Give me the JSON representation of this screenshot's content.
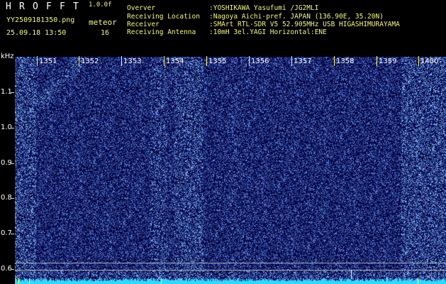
{
  "header": {
    "logo_letters": [
      "H",
      "R",
      "O",
      "F",
      "F",
      "T"
    ],
    "version": "1.0.0f",
    "filename": "YY2509181350.png",
    "datetime": "25.09.18 13:50",
    "meteor_label": "meteor",
    "meteor_count": "16",
    "info": [
      {
        "label": "Overver",
        "value": ":YOSHIKAWA Yasufumi /JG2MLI"
      },
      {
        "label": "Receiving Location",
        "value": ":Nagoya Aichi-pref. JAPAN (136.90E, 35.20N)"
      },
      {
        "label": "Receiver",
        "value": ":SMArt RTL-SDR V5 52.905MHz USB HIGASHIMURAYAMA"
      },
      {
        "label": "Receiving Antenna",
        "value": ":10mH 3el.YAGI Horizontal:ENE"
      }
    ]
  },
  "axis": {
    "y_unit": "kHz",
    "y_labels": [
      "1.1",
      "1.0",
      "0.9",
      "0.8",
      "0.7",
      "0.6"
    ],
    "x_labels": [
      "1351",
      "1352",
      "1353",
      "1354",
      "1355",
      "1356",
      "1357",
      "1358",
      "1359",
      "1400"
    ]
  },
  "colors": {
    "background": "#000000",
    "spectrum_low": "#00004a",
    "spectrum_high": "#7fb2ff",
    "minute_tick": "#ffff66",
    "header_yellow": "#f4f48c",
    "baseline_cyan": "#30d8ff"
  }
}
